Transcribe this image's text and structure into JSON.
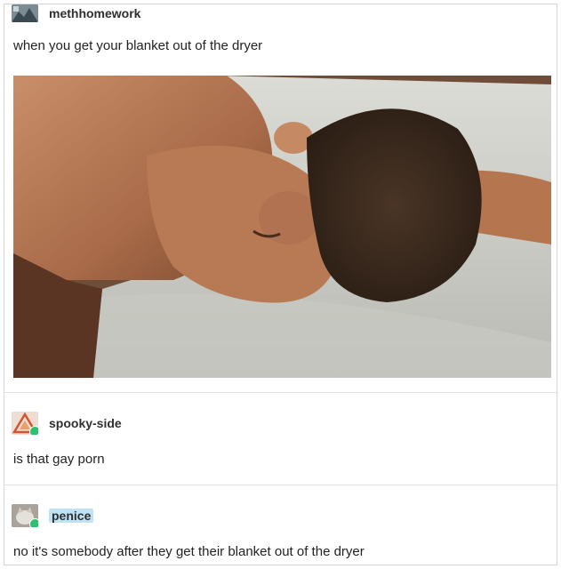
{
  "post": {
    "username": "methhomework",
    "caption": "when you get your blanket out of the dryer",
    "image_alt": "man lying face down on a fluffy white blanket"
  },
  "reblogs": [
    {
      "username": "spooky-side",
      "text": "is that gay porn"
    },
    {
      "username": "penice",
      "text": "no it's somebody after they get their blanket out of the dryer"
    }
  ],
  "colors": {
    "accent_badge": "#2fbf71",
    "username_highlight": "#bfe3f5"
  }
}
